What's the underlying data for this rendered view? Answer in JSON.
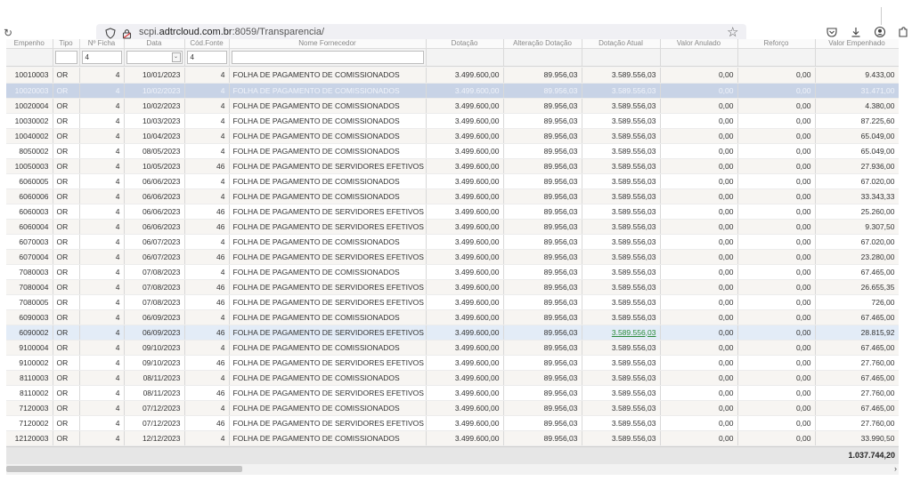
{
  "browser": {
    "url_prefix": "scpi.",
    "url_host": "adtrcloud.com.br",
    "url_rest": ":8059/Transparencia/"
  },
  "headers": [
    "Empenho",
    "Tipo",
    "Nº Ficha",
    "Data",
    "Cód.Fonte",
    "Nome Fornecedor",
    "Dotação",
    "Alteração Dotação",
    "Dotação Atual",
    "Valor Anulado",
    "Reforço",
    "Valor Empenhado"
  ],
  "filters": {
    "empenho": "",
    "tipo": "",
    "ficha": "4",
    "data": "",
    "fonte": "4",
    "fornecedor": ""
  },
  "rows": [
    [
      "10010003",
      "OR",
      "4",
      "10/01/2023",
      "4",
      "FOLHA DE PAGAMENTO DE COMISSIONADOS",
      "3.499.600,00",
      "89.956,03",
      "3.589.556,03",
      "0,00",
      "0,00",
      "9.433,00"
    ],
    [
      "10020003",
      "OR",
      "4",
      "10/02/2023",
      "4",
      "FOLHA DE PAGAMENTO DE COMISSIONADOS",
      "3.499.600,00",
      "89.956,03",
      "3.589.556,03",
      "0,00",
      "0,00",
      "31.471,00"
    ],
    [
      "10020004",
      "OR",
      "4",
      "10/02/2023",
      "4",
      "FOLHA DE PAGAMENTO DE COMISSIONADOS",
      "3.499.600,00",
      "89.956,03",
      "3.589.556,03",
      "0,00",
      "0,00",
      "4.380,00"
    ],
    [
      "10030002",
      "OR",
      "4",
      "10/03/2023",
      "4",
      "FOLHA DE PAGAMENTO DE COMISSIONADOS",
      "3.499.600,00",
      "89.956,03",
      "3.589.556,03",
      "0,00",
      "0,00",
      "87.225,60"
    ],
    [
      "10040002",
      "OR",
      "4",
      "10/04/2023",
      "4",
      "FOLHA DE PAGAMENTO DE COMISSIONADOS",
      "3.499.600,00",
      "89.956,03",
      "3.589.556,03",
      "0,00",
      "0,00",
      "65.049,00"
    ],
    [
      "8050002",
      "OR",
      "4",
      "08/05/2023",
      "4",
      "FOLHA DE PAGAMENTO DE COMISSIONADOS",
      "3.499.600,00",
      "89.956,03",
      "3.589.556,03",
      "0,00",
      "0,00",
      "65.049,00"
    ],
    [
      "10050003",
      "OR",
      "4",
      "10/05/2023",
      "46",
      "FOLHA DE PAGAMENTO DE SERVIDORES EFETIVOS",
      "3.499.600,00",
      "89.956,03",
      "3.589.556,03",
      "0,00",
      "0,00",
      "27.936,00"
    ],
    [
      "6060005",
      "OR",
      "4",
      "06/06/2023",
      "4",
      "FOLHA DE PAGAMENTO DE COMISSIONADOS",
      "3.499.600,00",
      "89.956,03",
      "3.589.556,03",
      "0,00",
      "0,00",
      "67.020,00"
    ],
    [
      "6060006",
      "OR",
      "4",
      "06/06/2023",
      "4",
      "FOLHA DE PAGAMENTO DE COMISSIONADOS",
      "3.499.600,00",
      "89.956,03",
      "3.589.556,03",
      "0,00",
      "0,00",
      "33.343,33"
    ],
    [
      "6060003",
      "OR",
      "4",
      "06/06/2023",
      "46",
      "FOLHA DE PAGAMENTO DE SERVIDORES EFETIVOS",
      "3.499.600,00",
      "89.956,03",
      "3.589.556,03",
      "0,00",
      "0,00",
      "25.260,00"
    ],
    [
      "6060004",
      "OR",
      "4",
      "06/06/2023",
      "46",
      "FOLHA DE PAGAMENTO DE SERVIDORES EFETIVOS",
      "3.499.600,00",
      "89.956,03",
      "3.589.556,03",
      "0,00",
      "0,00",
      "9.307,50"
    ],
    [
      "6070003",
      "OR",
      "4",
      "06/07/2023",
      "4",
      "FOLHA DE PAGAMENTO DE COMISSIONADOS",
      "3.499.600,00",
      "89.956,03",
      "3.589.556,03",
      "0,00",
      "0,00",
      "67.020,00"
    ],
    [
      "6070004",
      "OR",
      "4",
      "06/07/2023",
      "46",
      "FOLHA DE PAGAMENTO DE SERVIDORES EFETIVOS",
      "3.499.600,00",
      "89.956,03",
      "3.589.556,03",
      "0,00",
      "0,00",
      "23.280,00"
    ],
    [
      "7080003",
      "OR",
      "4",
      "07/08/2023",
      "4",
      "FOLHA DE PAGAMENTO DE COMISSIONADOS",
      "3.499.600,00",
      "89.956,03",
      "3.589.556,03",
      "0,00",
      "0,00",
      "67.465,00"
    ],
    [
      "7080004",
      "OR",
      "4",
      "07/08/2023",
      "46",
      "FOLHA DE PAGAMENTO DE SERVIDORES EFETIVOS",
      "3.499.600,00",
      "89.956,03",
      "3.589.556,03",
      "0,00",
      "0,00",
      "26.655,35"
    ],
    [
      "7080005",
      "OR",
      "4",
      "07/08/2023",
      "46",
      "FOLHA DE PAGAMENTO DE SERVIDORES EFETIVOS",
      "3.499.600,00",
      "89.956,03",
      "3.589.556,03",
      "0,00",
      "0,00",
      "726,00"
    ],
    [
      "6090003",
      "OR",
      "4",
      "06/09/2023",
      "4",
      "FOLHA DE PAGAMENTO DE COMISSIONADOS",
      "3.499.600,00",
      "89.956,03",
      "3.589.556,03",
      "0,00",
      "0,00",
      "67.465,00"
    ],
    [
      "6090002",
      "OR",
      "4",
      "06/09/2023",
      "46",
      "FOLHA DE PAGAMENTO DE SERVIDORES EFETIVOS",
      "3.499.600,00",
      "89.956,03",
      "3.589.556,03",
      "0,00",
      "0,00",
      "28.815,92"
    ],
    [
      "9100004",
      "OR",
      "4",
      "09/10/2023",
      "4",
      "FOLHA DE PAGAMENTO DE COMISSIONADOS",
      "3.499.600,00",
      "89.956,03",
      "3.589.556,03",
      "0,00",
      "0,00",
      "67.465,00"
    ],
    [
      "9100002",
      "OR",
      "4",
      "09/10/2023",
      "46",
      "FOLHA DE PAGAMENTO DE SERVIDORES EFETIVOS",
      "3.499.600,00",
      "89.956,03",
      "3.589.556,03",
      "0,00",
      "0,00",
      "27.760,00"
    ],
    [
      "8110003",
      "OR",
      "4",
      "08/11/2023",
      "4",
      "FOLHA DE PAGAMENTO DE COMISSIONADOS",
      "3.499.600,00",
      "89.956,03",
      "3.589.556,03",
      "0,00",
      "0,00",
      "67.465,00"
    ],
    [
      "8110002",
      "OR",
      "4",
      "08/11/2023",
      "46",
      "FOLHA DE PAGAMENTO DE SERVIDORES EFETIVOS",
      "3.499.600,00",
      "89.956,03",
      "3.589.556,03",
      "0,00",
      "0,00",
      "27.760,00"
    ],
    [
      "7120003",
      "OR",
      "4",
      "07/12/2023",
      "4",
      "FOLHA DE PAGAMENTO DE COMISSIONADOS",
      "3.499.600,00",
      "89.956,03",
      "3.589.556,03",
      "0,00",
      "0,00",
      "67.465,00"
    ],
    [
      "7120002",
      "OR",
      "4",
      "07/12/2023",
      "46",
      "FOLHA DE PAGAMENTO DE SERVIDORES EFETIVOS",
      "3.499.600,00",
      "89.956,03",
      "3.589.556,03",
      "0,00",
      "0,00",
      "27.760,00"
    ],
    [
      "12120003",
      "OR",
      "4",
      "12/12/2023",
      "4",
      "FOLHA DE PAGAMENTO DE COMISSIONADOS",
      "3.499.600,00",
      "89.956,03",
      "3.589.556,03",
      "0,00",
      "0,00",
      "33.990,50"
    ]
  ],
  "selected_row": 1,
  "hover_row": 17,
  "total": "1.037.744,20",
  "icons": {
    "reload": "reload-icon",
    "shield": "shield-icon",
    "lock": "lock-icon",
    "star": "star-icon",
    "pocket": "pocket-icon",
    "download": "download-icon",
    "account": "account-icon",
    "extensions": "extensions-icon"
  }
}
